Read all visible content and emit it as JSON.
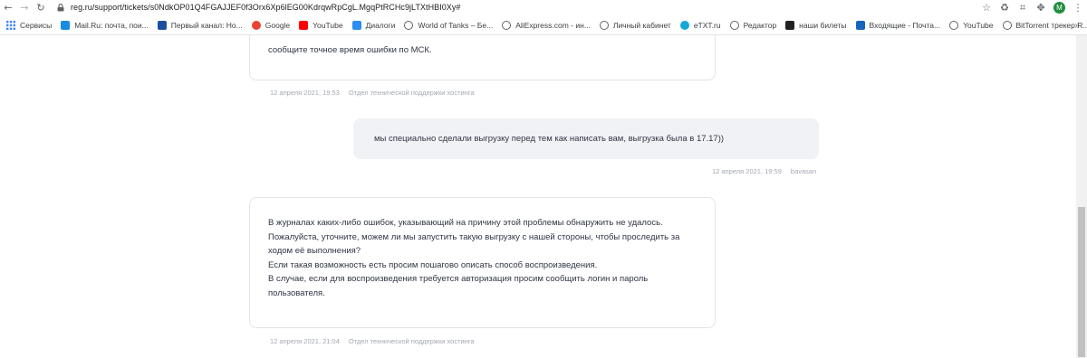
{
  "browser": {
    "url_host": "reg.ru",
    "url_path": "/support/tickets/s0NdkOP01Q4FGAJJEF0f3Orx6Xp6lEG00KdrqwRpCgL.MgqPtRCHc9jLTXtHBI0Xy#",
    "profile_initial": "M",
    "bookmarks": [
      {
        "label": "Сервисы",
        "icon": "apps-grid-icon",
        "color": "#4285f4"
      },
      {
        "label": "Mail.Ru: почта, пои...",
        "icon": "mailru-icon",
        "color": "#168de2"
      },
      {
        "label": "Первый канал: Но...",
        "icon": "channel-one-icon",
        "color": "#1a4fa0"
      },
      {
        "label": "Google",
        "icon": "google-icon",
        "color": "#ea4335"
      },
      {
        "label": "YouTube",
        "icon": "youtube-icon",
        "color": "#ff0000"
      },
      {
        "label": "Диалоги",
        "icon": "dialogs-icon",
        "color": "#2d8cf0"
      },
      {
        "label": "World of Tanks – Бе...",
        "icon": "globe-icon",
        "color": "#5f6368"
      },
      {
        "label": "AliExpress.com - ин...",
        "icon": "globe-icon",
        "color": "#5f6368"
      },
      {
        "label": "Личный кабинет",
        "icon": "globe-icon",
        "color": "#5f6368"
      },
      {
        "label": "eTXT.ru",
        "icon": "etxt-icon",
        "color": "#14a7d8"
      },
      {
        "label": "Редактор",
        "icon": "globe-icon",
        "color": "#5f6368"
      },
      {
        "label": "наши билеты",
        "icon": "k-logo-icon",
        "color": "#222222"
      },
      {
        "label": "Входящие - Почта...",
        "icon": "mail-inbox-icon",
        "color": "#1565c0"
      },
      {
        "label": "YouTube",
        "icon": "globe-icon",
        "color": "#5f6368"
      },
      {
        "label": "BitTorrent трекер R...",
        "icon": "globe-icon",
        "color": "#5f6368"
      }
    ],
    "more_label": "»"
  },
  "messages": [
    {
      "author": "support",
      "lines": [
        "сообщите точное время ошибки по МСК."
      ],
      "time": "12 апреля 2021, 19:53",
      "sender": "Отдел технической поддержки хостинга"
    },
    {
      "author": "user",
      "lines": [
        "мы специально сделали выгрузку перед тем как написать вам, выгрузка была в 17.17))"
      ],
      "time": "12 апреля 2021, 19:59",
      "sender": "bavasan"
    },
    {
      "author": "support",
      "lines": [
        "В журналах каких-либо ошибок, указывающий на причину этой проблемы обнаружить не удалось.",
        "Пожалуйста, уточните, можем ли мы запустить такую выгрузку с нашей стороны, чтобы проследить за",
        "ходом её выполнения?",
        "Если такая возможность есть просим пошагово описать способ воспроизведения.",
        "В случае, если для воспроизведения требуется авторизация просим сообщить логин и пароль",
        "пользователя."
      ],
      "time": "12 апреля 2021, 21:04",
      "sender": "Отдел технической поддержки хостинга"
    }
  ]
}
